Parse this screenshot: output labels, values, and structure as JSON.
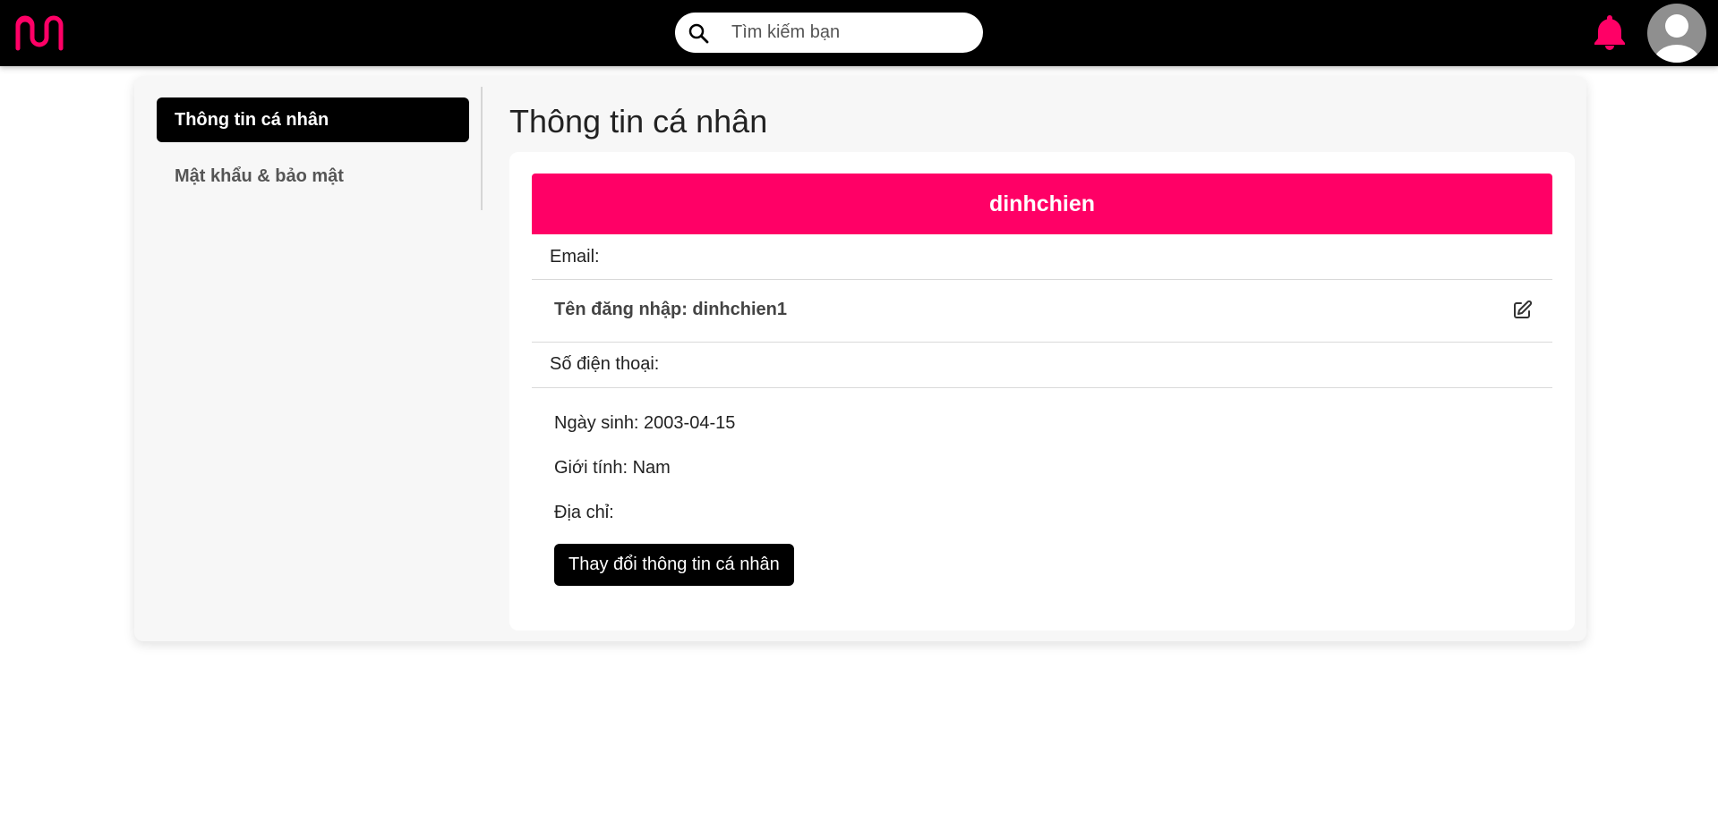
{
  "topbar": {
    "logo_icon": "wave-m-logo-icon",
    "brand_color": "#ff0066",
    "search": {
      "placeholder": "Tìm kiếm bạn",
      "value": "",
      "icon": "search-icon"
    },
    "notification_icon": "bell-icon",
    "avatar_icon": "user-avatar-icon"
  },
  "sidebar": {
    "items": [
      {
        "label": "Thông tin cá nhân",
        "active": true
      },
      {
        "label": "Mật khẩu & bảo mật",
        "active": false
      }
    ]
  },
  "main": {
    "title": "Thông tin cá nhân",
    "profile": {
      "display_name": "dinhchien",
      "email_label": "Email:",
      "username_label": "Tên đăng nhập: dinhchien1",
      "phone_label": "Số điện thoại:",
      "dob_label": "Ngày sinh: 2003-04-15",
      "gender_label": "Giới tính: Nam",
      "address_label": "Địa chỉ:",
      "edit_icon": "edit-icon"
    },
    "change_button_label": "Thay đổi thông tin cá nhân"
  },
  "colors": {
    "accent": "#ff0066",
    "topbar_bg": "#000000",
    "panel_bg": "#f7f7f7",
    "card_bg": "#ffffff"
  }
}
